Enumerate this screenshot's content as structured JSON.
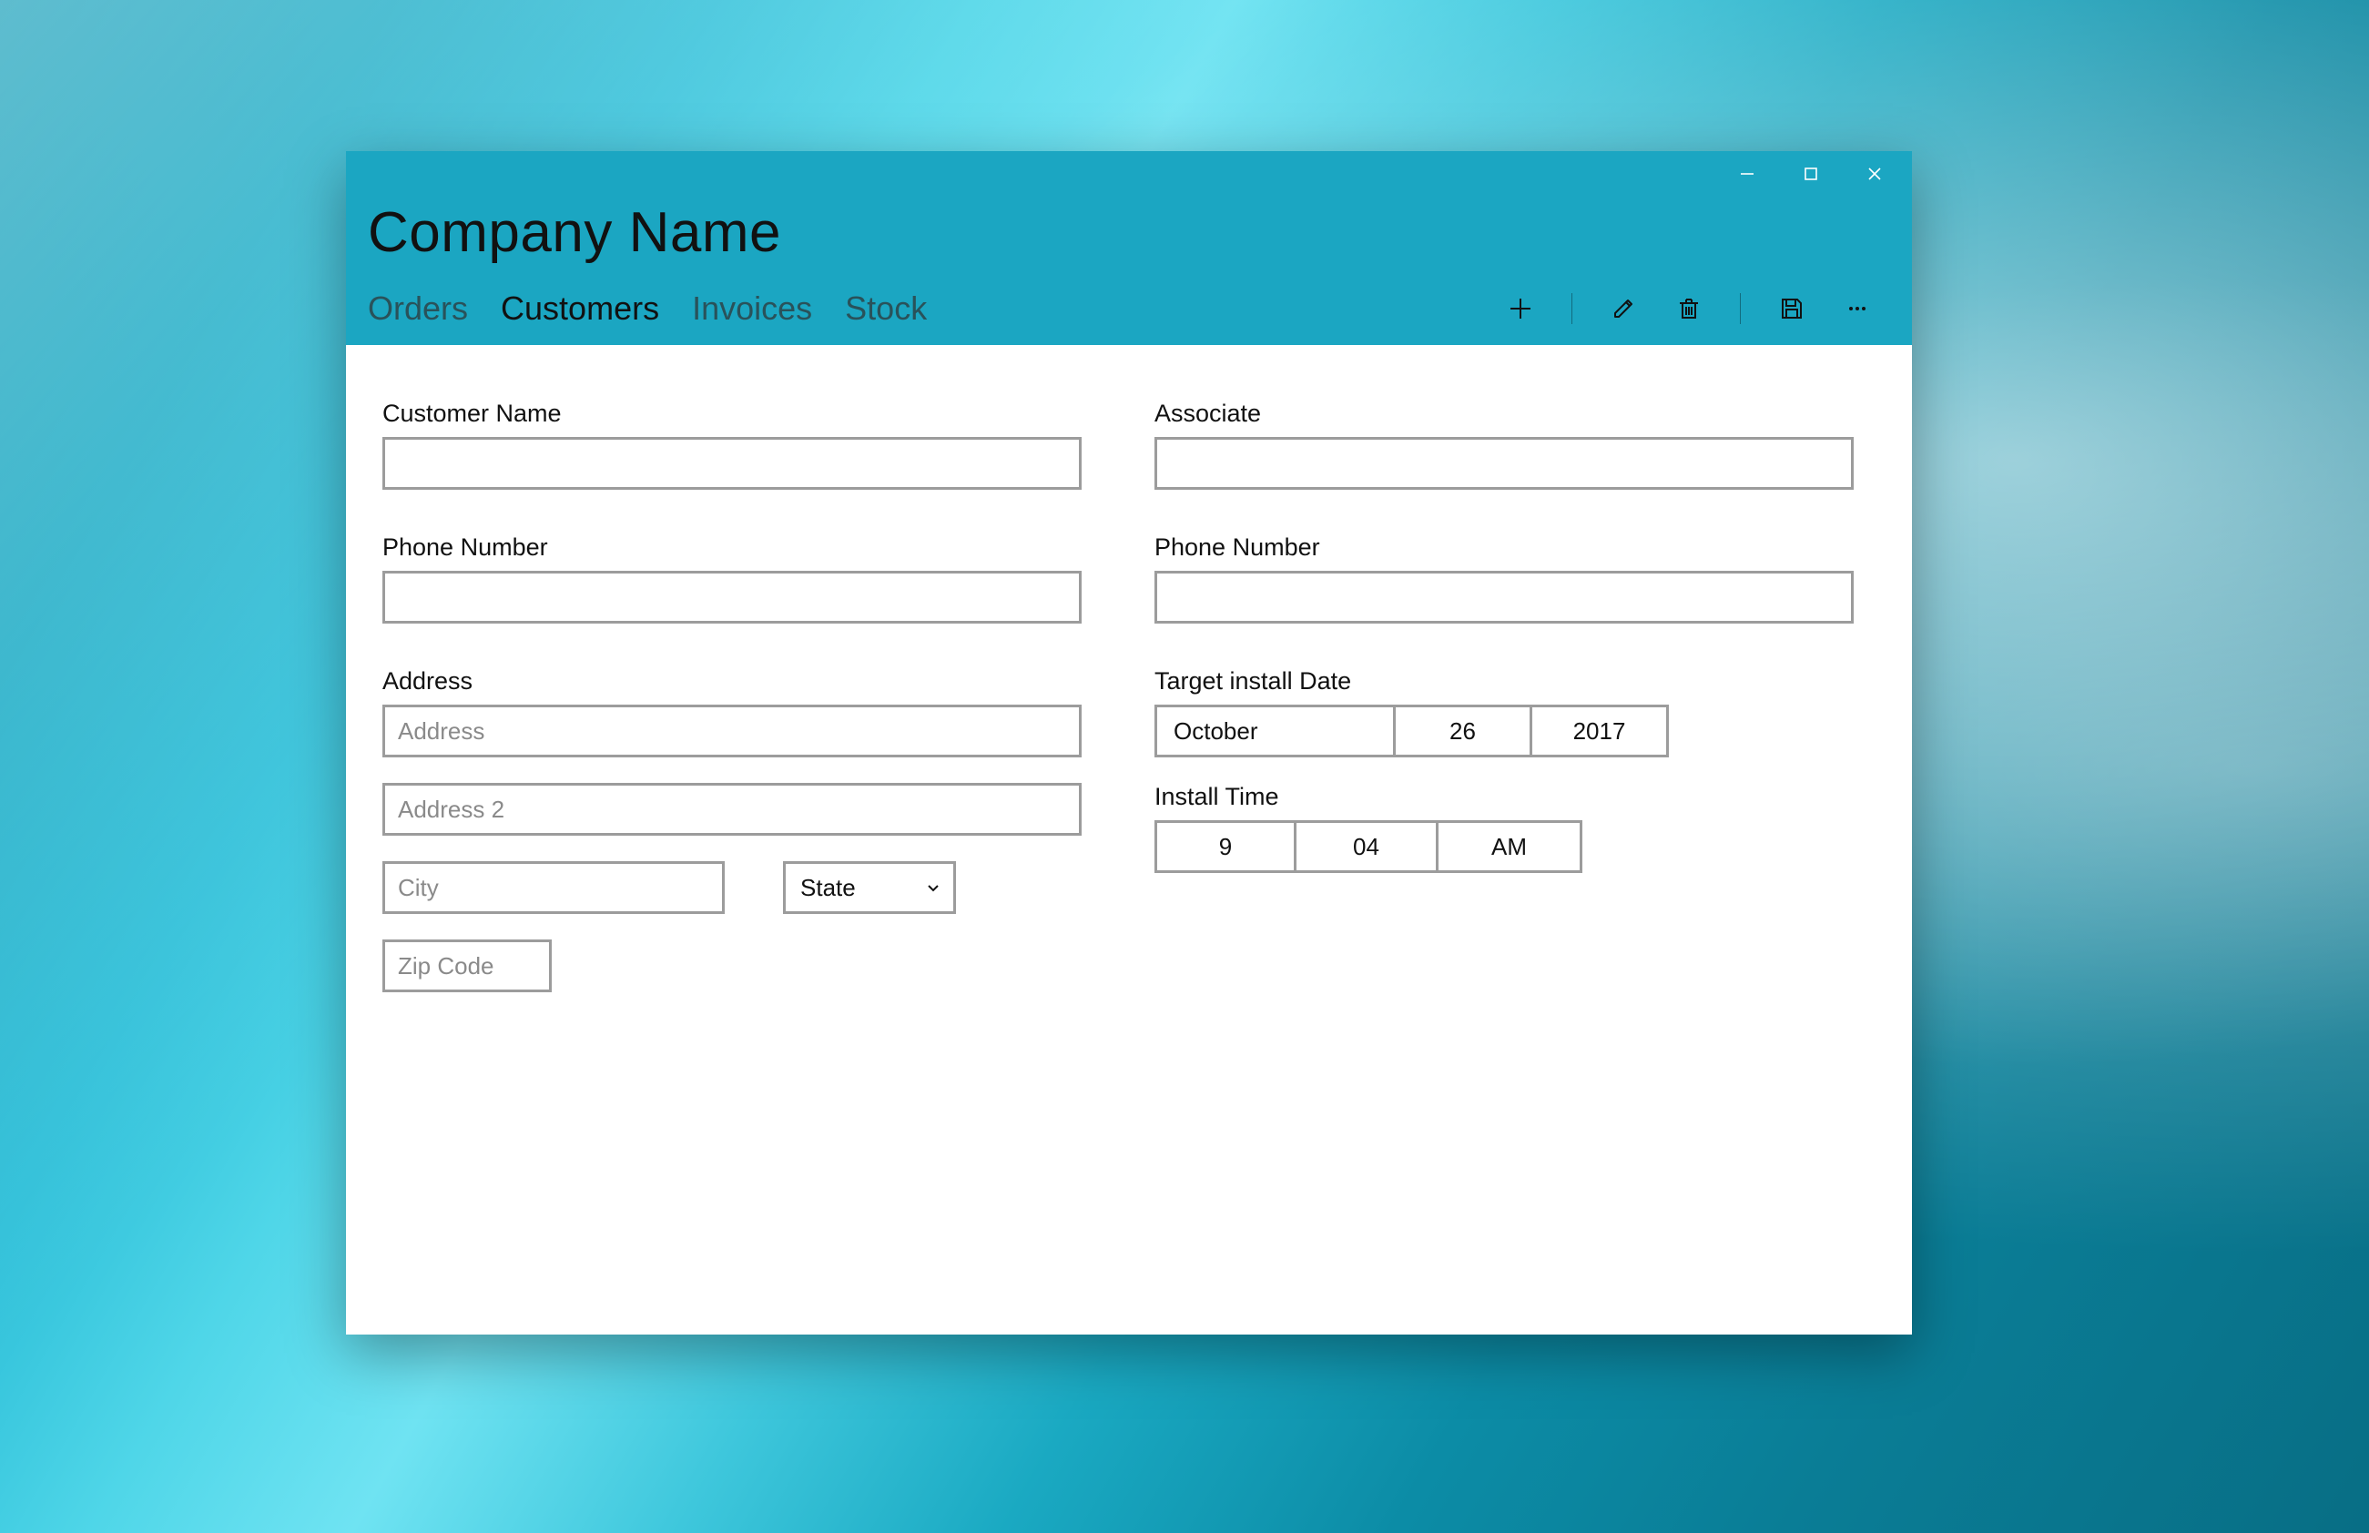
{
  "app": {
    "title": "Company Name"
  },
  "tabs": {
    "orders": "Orders",
    "customers": "Customers",
    "invoices": "Invoices",
    "stock": "Stock"
  },
  "toolbar_icons": {
    "add": "add-icon",
    "edit": "edit-icon",
    "delete": "delete-icon",
    "save": "save-icon",
    "more": "more-icon"
  },
  "left": {
    "customer_name_label": "Customer Name",
    "customer_name_value": "",
    "phone_label": "Phone Number",
    "phone_value": "",
    "address_label": "Address",
    "address1_placeholder": "Address",
    "address1_value": "",
    "address2_placeholder": "Address 2",
    "address2_value": "",
    "city_placeholder": "City",
    "city_value": "",
    "state_label": "State",
    "zip_placeholder": "Zip Code",
    "zip_value": ""
  },
  "right": {
    "associate_label": "Associate",
    "associate_value": "",
    "phone_label": "Phone Number",
    "phone_value": "",
    "install_date_label": "Target install Date",
    "install_date": {
      "month": "October",
      "day": "26",
      "year": "2017"
    },
    "install_time_label": "Install Time",
    "install_time": {
      "hour": "9",
      "minute": "04",
      "ampm": "AM"
    }
  }
}
